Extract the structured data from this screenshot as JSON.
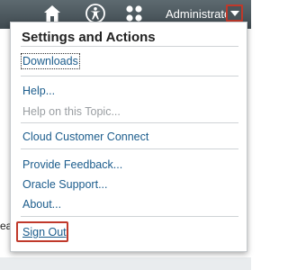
{
  "header": {
    "user_name": "Administrator",
    "icons": [
      "home-icon",
      "accessibility-icon",
      "apps-grid-icon",
      "chevron-down-icon"
    ]
  },
  "background": {
    "partial_text": "ea"
  },
  "menu": {
    "title": "Settings and Actions",
    "items": {
      "downloads": "Downloads",
      "help": "Help...",
      "help_topic": "Help on this Topic...",
      "cloud_connect": "Cloud Customer Connect",
      "feedback": "Provide Feedback...",
      "oracle_support": "Oracle Support...",
      "about": "About...",
      "sign_out": "Sign Out"
    }
  },
  "colors": {
    "header": "#4a555b",
    "link": "#1b5c8c",
    "disabled": "#9a9ea2",
    "highlight": "#c0392b"
  }
}
